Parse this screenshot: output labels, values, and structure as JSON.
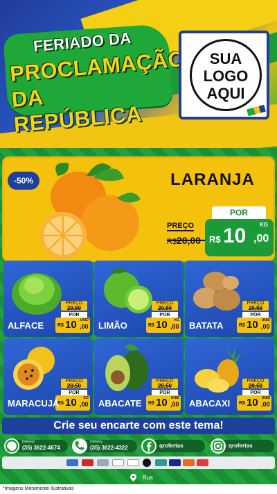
{
  "header": {
    "title_line1": "FERIADO DA",
    "title_line2": "PROCLAMAÇÃO",
    "title_line3": "DA REPÚBLICA",
    "logo_line1": "SUA",
    "logo_line2": "LOGO",
    "logo_line3": "AQUI"
  },
  "hero": {
    "discount": "-50%",
    "name": "LARANJA",
    "preco_label": "PREÇO",
    "old_currency": "R$",
    "old_price": "20,00",
    "por_label": "POR",
    "currency": "R$",
    "price_int": "10",
    "price_cents": ",00",
    "unit": "KG"
  },
  "products": [
    {
      "name": "ALFACE",
      "old": "20,50",
      "int": "10",
      "cents": ",00",
      "unit": "UNID",
      "icon": "lettuce-image"
    },
    {
      "name": "LIMÃO",
      "old": "20,50",
      "int": "10",
      "cents": ",00",
      "unit": "KG",
      "icon": "lime-image"
    },
    {
      "name": "BATATA",
      "old": "20,50",
      "int": "10",
      "cents": ",00",
      "unit": "UNID",
      "icon": "potato-image"
    },
    {
      "name": "MARACUJÁ",
      "old": "20,50",
      "int": "10",
      "cents": ",00",
      "unit": "KG",
      "icon": "passionfruit-image"
    },
    {
      "name": "ABACATE",
      "old": "20,50",
      "int": "10",
      "cents": ",00",
      "unit": "UNID",
      "icon": "avocado-image"
    },
    {
      "name": "ABACAXI",
      "old": "20,50",
      "int": "10",
      "cents": ",00",
      "unit": "UNID",
      "icon": "pineapple-image"
    }
  ],
  "labels": {
    "preco": "PREÇO",
    "por": "POR",
    "currency": "R$"
  },
  "banner": "Crie seu encarte com este tema!",
  "contacts": {
    "whatsapp_sub": "Delivery",
    "whatsapp": "(35) 3622-4674",
    "phone_sub": "Delivery",
    "phone": "(35) 3622-4322",
    "facebook": "qrofertas",
    "instagram": "qrofertas"
  },
  "address": "Rua",
  "footer_note": "*Imagens Meramente Ilustrativas",
  "colors": {
    "green": "#1a8a2e",
    "yellow": "#f4c20d",
    "blue": "#1d3f9e"
  }
}
